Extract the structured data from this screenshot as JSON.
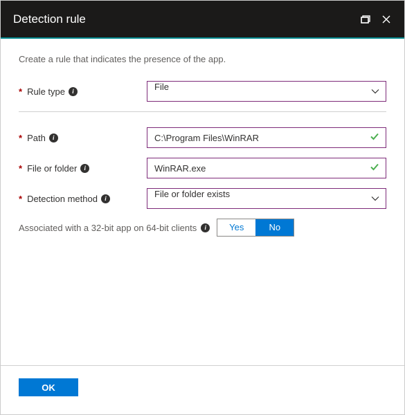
{
  "header": {
    "title": "Detection rule"
  },
  "description": "Create a rule that indicates the presence of the app.",
  "fields": {
    "ruleType": {
      "label": "Rule type",
      "value": "File"
    },
    "path": {
      "label": "Path",
      "value": "C:\\Program Files\\WinRAR"
    },
    "fileOrFolder": {
      "label": "File or folder",
      "value": "WinRAR.exe"
    },
    "detectionMethod": {
      "label": "Detection method",
      "value": "File or folder exists"
    }
  },
  "assoc32": {
    "label": "Associated with a 32-bit app on 64-bit clients",
    "options": {
      "yes": "Yes",
      "no": "No"
    },
    "selected": "no"
  },
  "buttons": {
    "ok": "OK"
  }
}
